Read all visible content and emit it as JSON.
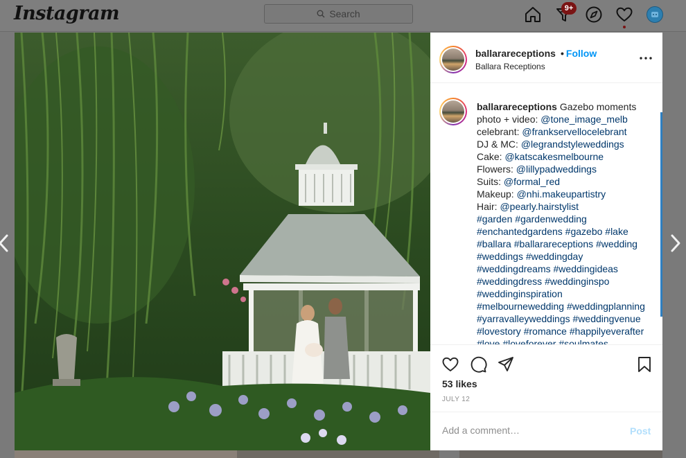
{
  "nav": {
    "logo": "Instagram",
    "search_placeholder": "Search",
    "activity_badge": "9+"
  },
  "post": {
    "username": "ballarareceptions",
    "follow_label": "Follow",
    "follow_separator": "•",
    "display_name": "Ballara Receptions",
    "caption_user": "ballarareceptions",
    "caption_lines": [
      "Gazebo moments",
      "photo + video: @tone_image_melb",
      "celebrant: @frankservellocelebrant",
      "DJ & MC: @legrandstyleweddings",
      "Cake: @katscakesmelbourne",
      "Flowers: @lillypadweddings",
      "Suits: @formal_red",
      "Makeup: @nhi.makeupartistry",
      "Hair: @pearly.hairstylist",
      "#garden #gardenwedding",
      "#enchantedgardens #gazebo #lake",
      "#ballara #ballarareceptions #wedding",
      "#weddings #weddingday",
      "#weddingdreams #weddingideas",
      "#weddingdress #weddinginspo",
      "#weddinginspiration",
      "#melbournewedding #weddingplanning",
      "#yarravalleyweddings #weddingvenue",
      "#lovestory #romance #happilyeverafter",
      "#love #loveforever #soulmates"
    ],
    "likes": "53 likes",
    "date": "JULY 12",
    "comment_placeholder": "Add a comment…",
    "post_label": "Post"
  },
  "icons": {
    "home": "home-icon",
    "direct": "filter-inbox-icon",
    "explore": "compass-icon",
    "activity": "heart-icon",
    "profile": "avatar",
    "like": "heart-icon",
    "comment": "comment-icon",
    "share": "share-icon",
    "save": "bookmark-icon",
    "more": "more-options-icon",
    "prev": "chevron-left-icon",
    "next": "chevron-right-icon"
  },
  "colors": {
    "accent": "#0095f6",
    "link": "#00376b",
    "badge": "#7a1414"
  }
}
